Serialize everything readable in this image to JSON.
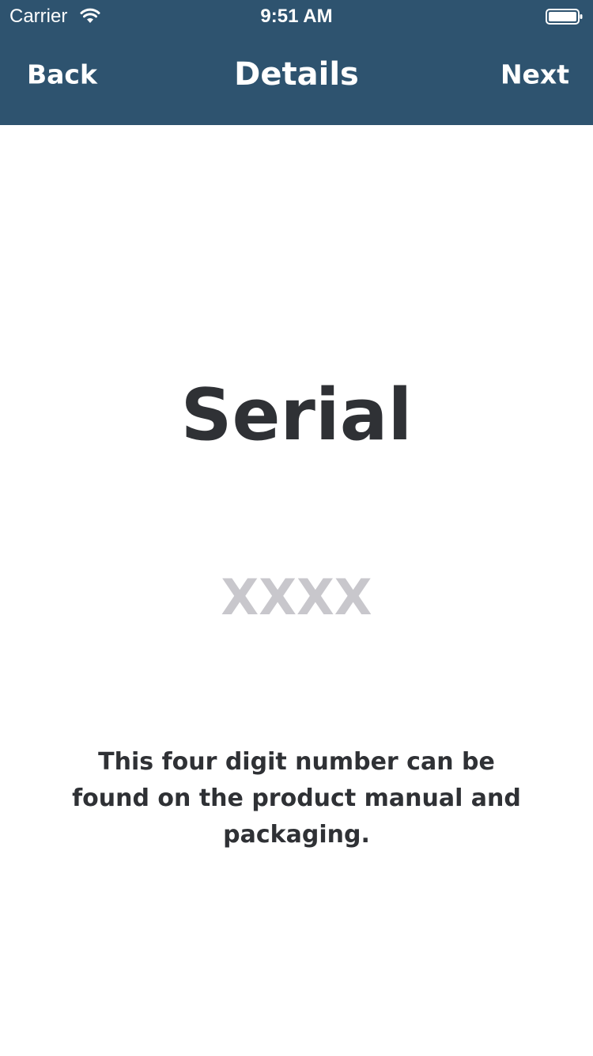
{
  "status_bar": {
    "carrier": "Carrier",
    "time": "9:51 AM",
    "wifi_icon": "wifi-icon",
    "battery_icon": "battery-icon"
  },
  "nav": {
    "back_label": "Back",
    "title": "Details",
    "next_label": "Next"
  },
  "main": {
    "heading": "Serial",
    "serial_field": {
      "value": "",
      "placeholder": "XXXX"
    },
    "hint": "This four digit number can be found on the product manual and packaging."
  },
  "colors": {
    "nav_background": "#2e536f",
    "text_dark": "#2f3135",
    "placeholder": "#c8c7cc",
    "background": "#ffffff"
  }
}
